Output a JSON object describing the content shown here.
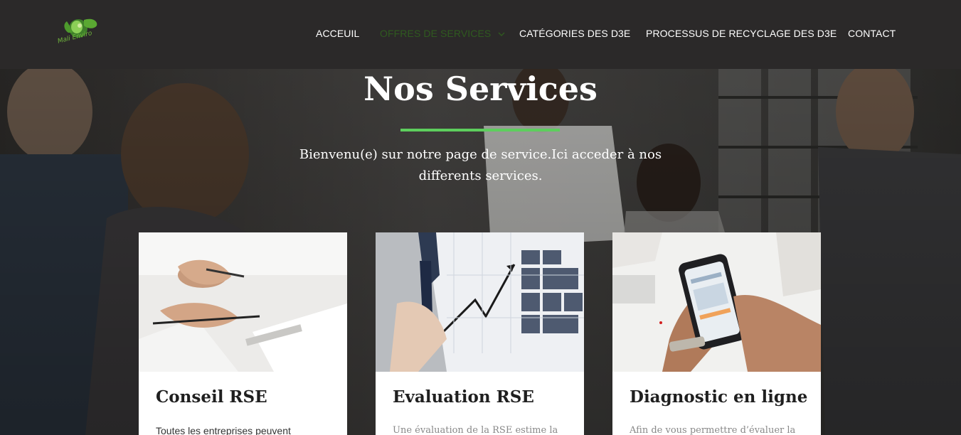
{
  "header": {
    "logo_text": "Mali Enviro",
    "nav": [
      {
        "label": "ACCEUIL"
      },
      {
        "label": "OFFRES DE SERVICES"
      },
      {
        "label": "CATÉGORIES DES D3E"
      },
      {
        "label": "PROCESSUS DE RECYCLAGE DES D3E"
      },
      {
        "label": "CONTACT"
      }
    ]
  },
  "hero": {
    "title": "Nos Services",
    "subtitle": "Bienvenu(e) sur notre page de service.Ici acceder à nos differents services."
  },
  "cards": [
    {
      "title": "Conseil RSE",
      "text": "Toutes les entreprises peuvent"
    },
    {
      "title": "Evaluation RSE",
      "text": "Une évaluation de la RSE estime la"
    },
    {
      "title": "Diagnostic en ligne",
      "text": "Afin de vous permettre d’évaluer la"
    }
  ],
  "colors": {
    "header_bg": "#2b2929",
    "accent_green": "#5dce5d",
    "active_nav": "#2f5a1f",
    "logo_green": "#6fb33c"
  }
}
